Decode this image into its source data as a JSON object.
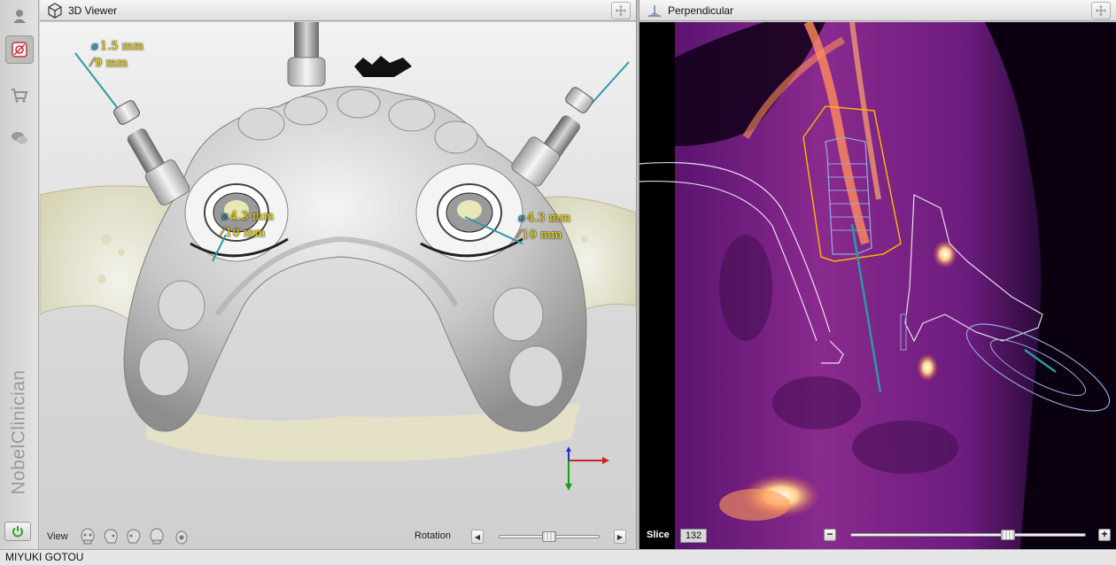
{
  "sidebar": {
    "brand": "NobelClinician",
    "icons": [
      "user-icon",
      "implant-planning-icon",
      "cart-icon",
      "chat-icon"
    ]
  },
  "viewer3d": {
    "title": "3D Viewer",
    "annotations": [
      {
        "diameter": "1.5 mm",
        "length": "9 mm"
      },
      {
        "diameter": "4.3 mm",
        "length": "10 mm"
      },
      {
        "diameter": "4.3 mm",
        "length": "10 mm"
      }
    ],
    "bottom": {
      "view_label": "View",
      "rotation_label": "Rotation",
      "rotation_level": 0.5
    }
  },
  "perpendicular": {
    "title": "Perpendicular",
    "slice_label": "Slice",
    "slice_value": "132",
    "slice_level": 0.67,
    "minus": "−",
    "plus": "+"
  },
  "status": {
    "patient_name": "MIYUKI GOTOU"
  },
  "colors": {
    "annotation_text": "#ffe600",
    "implant_axis": "#2a9aa4",
    "ct_background": "#7b1a8a"
  }
}
